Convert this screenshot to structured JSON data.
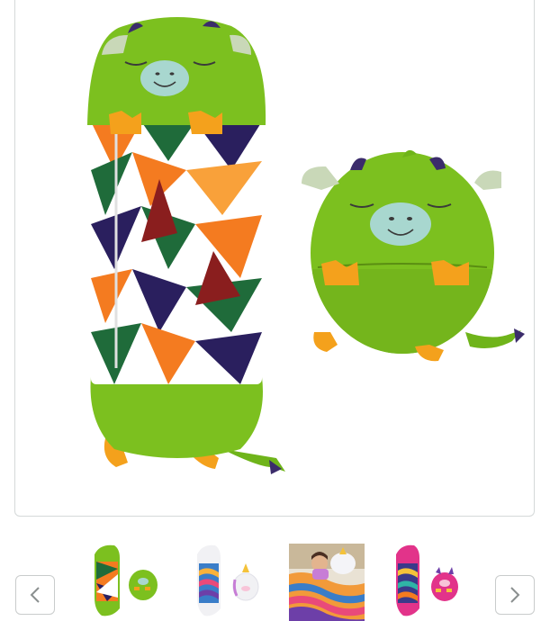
{
  "product_gallery": {
    "main_image": {
      "icon": "dragon-sleeping-bag-image",
      "accent_colors": {
        "green": "#7dc21e",
        "orange": "#f7a11a",
        "purple": "#3b2c6b"
      }
    },
    "nav": {
      "prev_icon": "chevron-left-icon",
      "next_icon": "chevron-right-icon"
    },
    "thumbnails": [
      {
        "icon": "green-dragon-thumbnail",
        "selected": false
      },
      {
        "icon": "unicorn-thumbnail",
        "selected": false
      },
      {
        "icon": "child-in-sleeping-bag-thumbnail",
        "selected": false
      },
      {
        "icon": "pink-dragon-thumbnail",
        "selected": false
      }
    ]
  }
}
